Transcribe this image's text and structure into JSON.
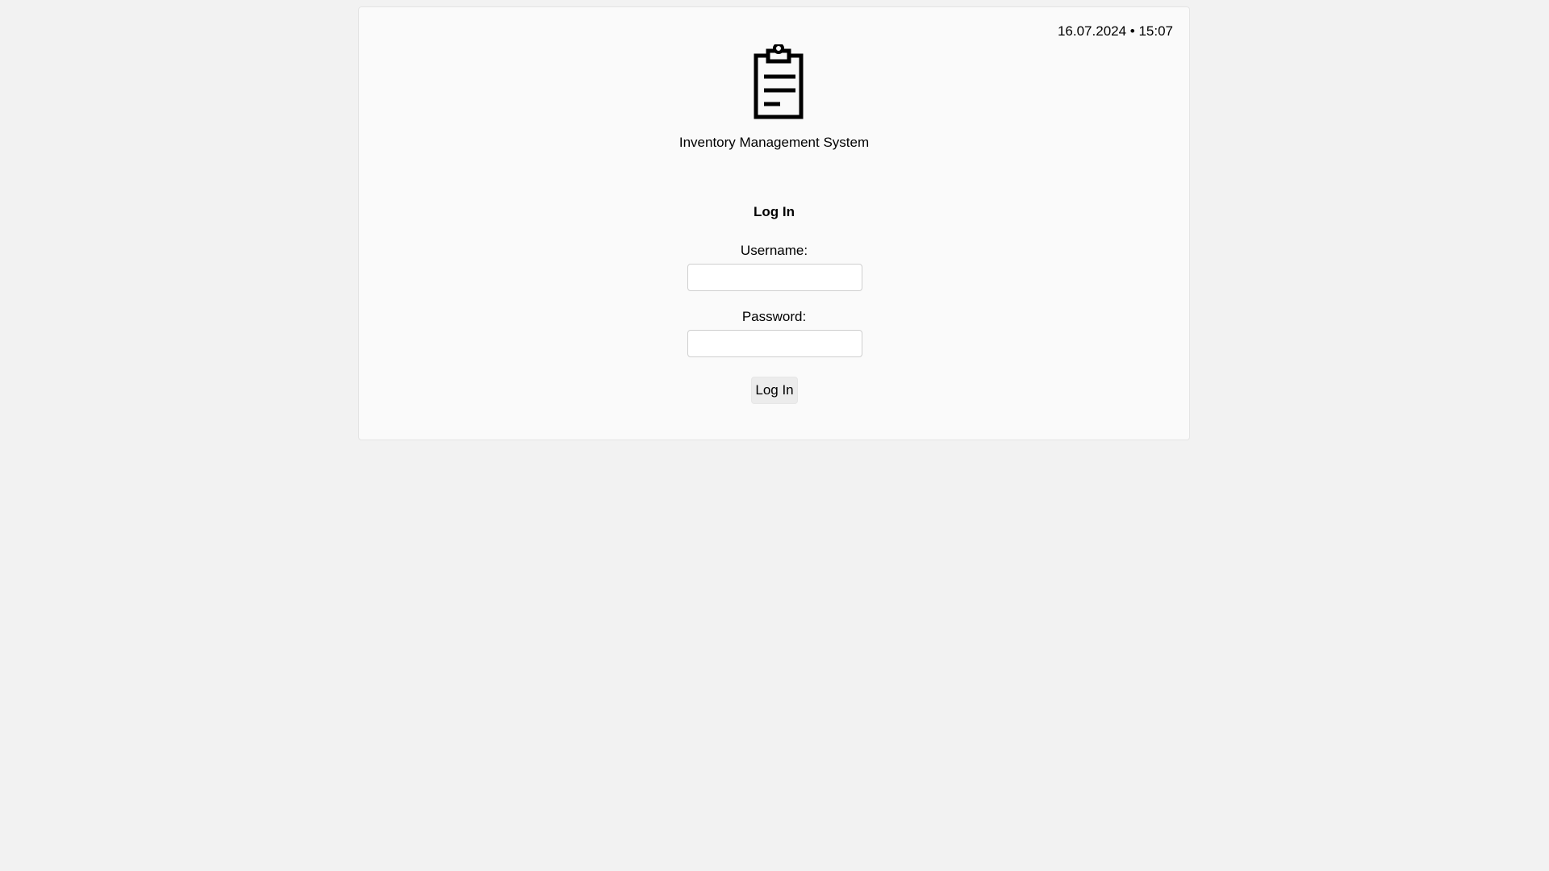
{
  "header": {
    "datetime": "16.07.2024 • 15:07"
  },
  "branding": {
    "logo_icon": "clipboard-icon",
    "app_name": "Inventory Management System"
  },
  "login_form": {
    "title": "Log In",
    "username_label": "Username:",
    "username_value": "",
    "password_label": "Password:",
    "password_value": "",
    "submit_label": "Log In"
  },
  "colors": {
    "page_background": "#f2f2f2",
    "card_background": "#fafafa",
    "button_background": "#ececec"
  }
}
